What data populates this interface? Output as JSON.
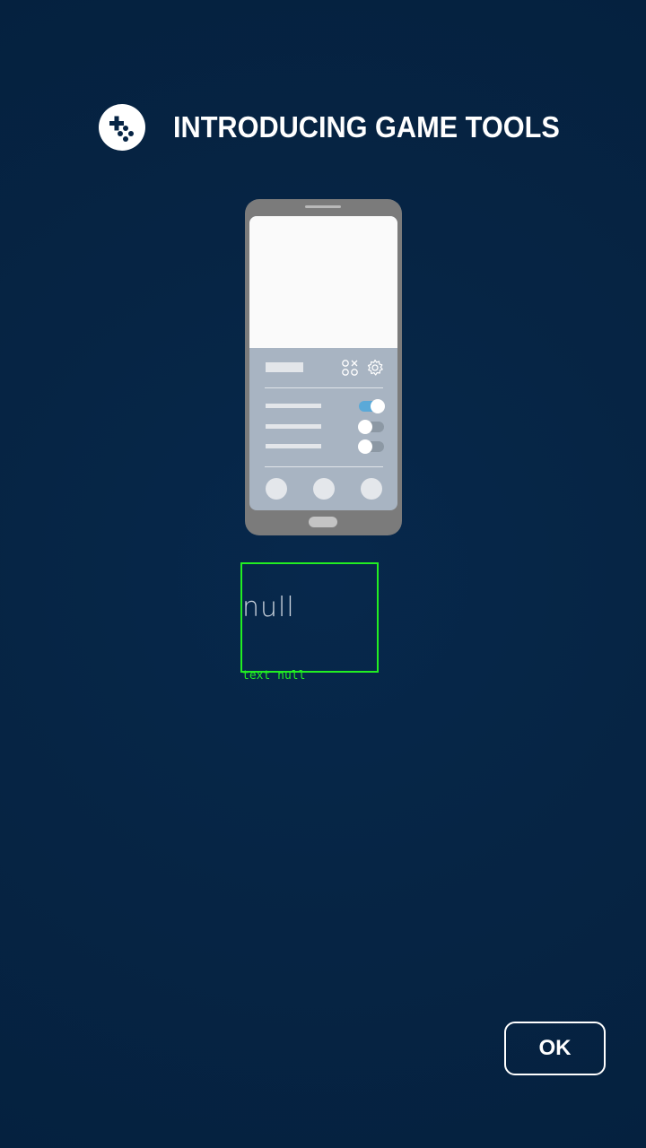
{
  "dialog": {
    "title": "INTRODUCING GAME TOOLS",
    "logo_icon": "game-controller-icon",
    "ok_label": "OK"
  },
  "illustration": {
    "panel_icons": [
      "game-tools-icon",
      "gear-icon"
    ],
    "toggles": [
      {
        "state": "on"
      },
      {
        "state": "off"
      },
      {
        "state": "off"
      }
    ]
  },
  "debug_overlay": {
    "value_text": "null",
    "caption": "text null"
  },
  "colors": {
    "background": "#062444",
    "accent_toggle": "#5aa9d8",
    "debug_box": "#22ee22"
  }
}
